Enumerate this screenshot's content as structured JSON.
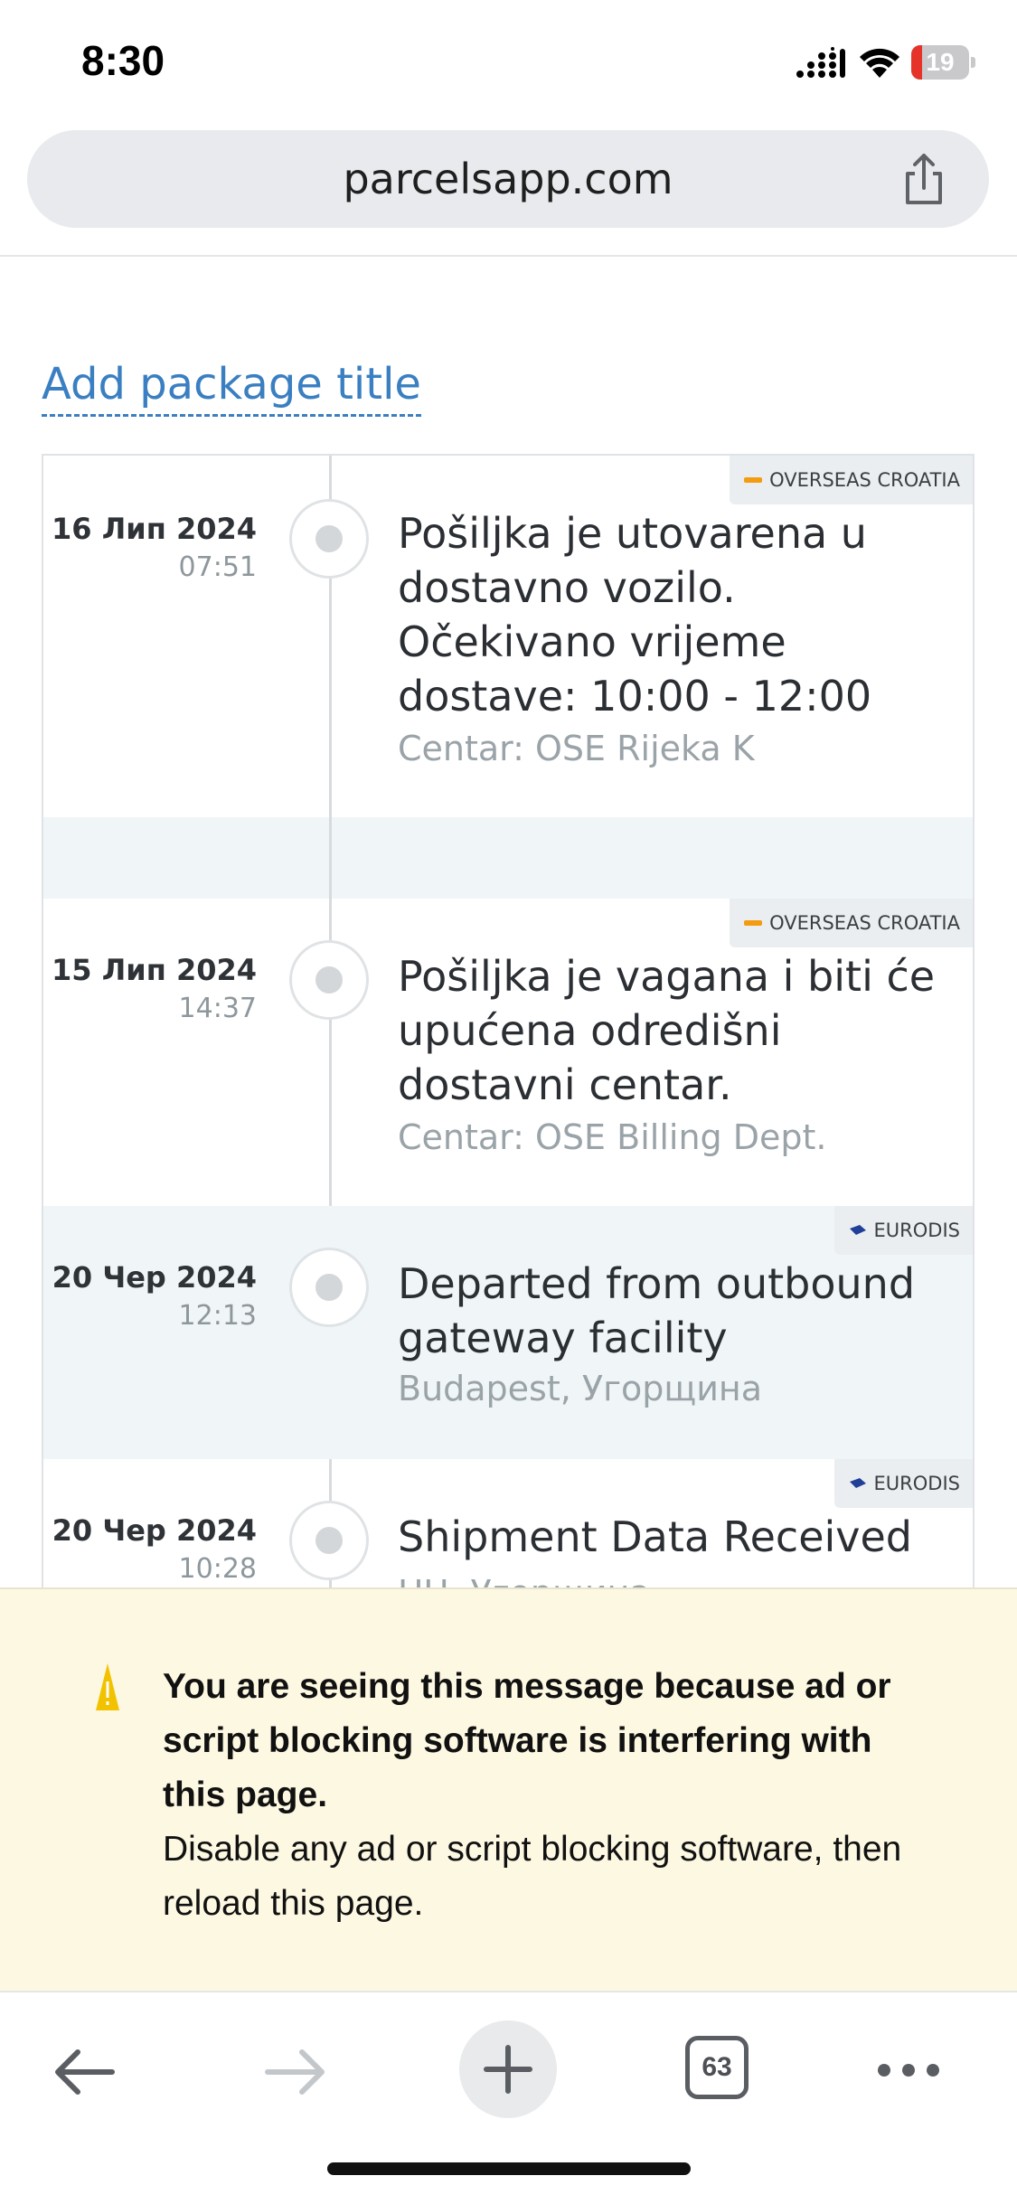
{
  "status_bar": {
    "time": "8:30",
    "battery_percent": 19,
    "battery_label": "19",
    "icons": [
      "signal-icon",
      "wifi-icon",
      "battery-icon"
    ]
  },
  "browser": {
    "url": "parcelsapp.com",
    "share_icon": "share-icon"
  },
  "package": {
    "title_link": "Add package title"
  },
  "events": [
    {
      "carrier": "OVERSEAS CROATIA",
      "date": "16 Лип 2024",
      "time": "07:51",
      "description": "Pošiljka je utovarena u dostavno vozilo. Očekivano vrijeme dostave: 10:00 - 12:00",
      "location": "Centar: OSE Rijeka K"
    },
    {
      "carrier": "OVERSEAS CROATIA",
      "date": "15 Лип 2024",
      "time": "14:37",
      "description": "Pošiljka je vagana i biti će upućena odredišni dostavni centar.",
      "location": "Centar: OSE Billing Dept."
    },
    {
      "carrier": "EURODIS",
      "date": "20 Чер 2024",
      "time": "12:13",
      "description": "Departed from outbound gateway facility",
      "location": "Budapest, Угорщина"
    },
    {
      "carrier": "EURODIS",
      "date": "20 Чер 2024",
      "time": "10:28",
      "description": "Shipment Data Received",
      "location": "HU, Угорщина"
    }
  ],
  "adblock_notice": {
    "icon": "warning-icon",
    "strong": "You are seeing this message because ad or script blocking software is interfering with this page.",
    "text": "Disable any ad or script blocking software, then reload this page."
  },
  "toolbar": {
    "back_icon": "back-arrow-icon",
    "forward_icon": "forward-arrow-icon",
    "new_tab_icon": "plus-icon",
    "tab_count": "63",
    "more_icon": "more-icon"
  },
  "colors": {
    "link": "#3a7fc1",
    "banner_bg": "#fdf8e2",
    "alt_row_bg": "#f0f6f7",
    "battery_low": "#e5332a"
  }
}
